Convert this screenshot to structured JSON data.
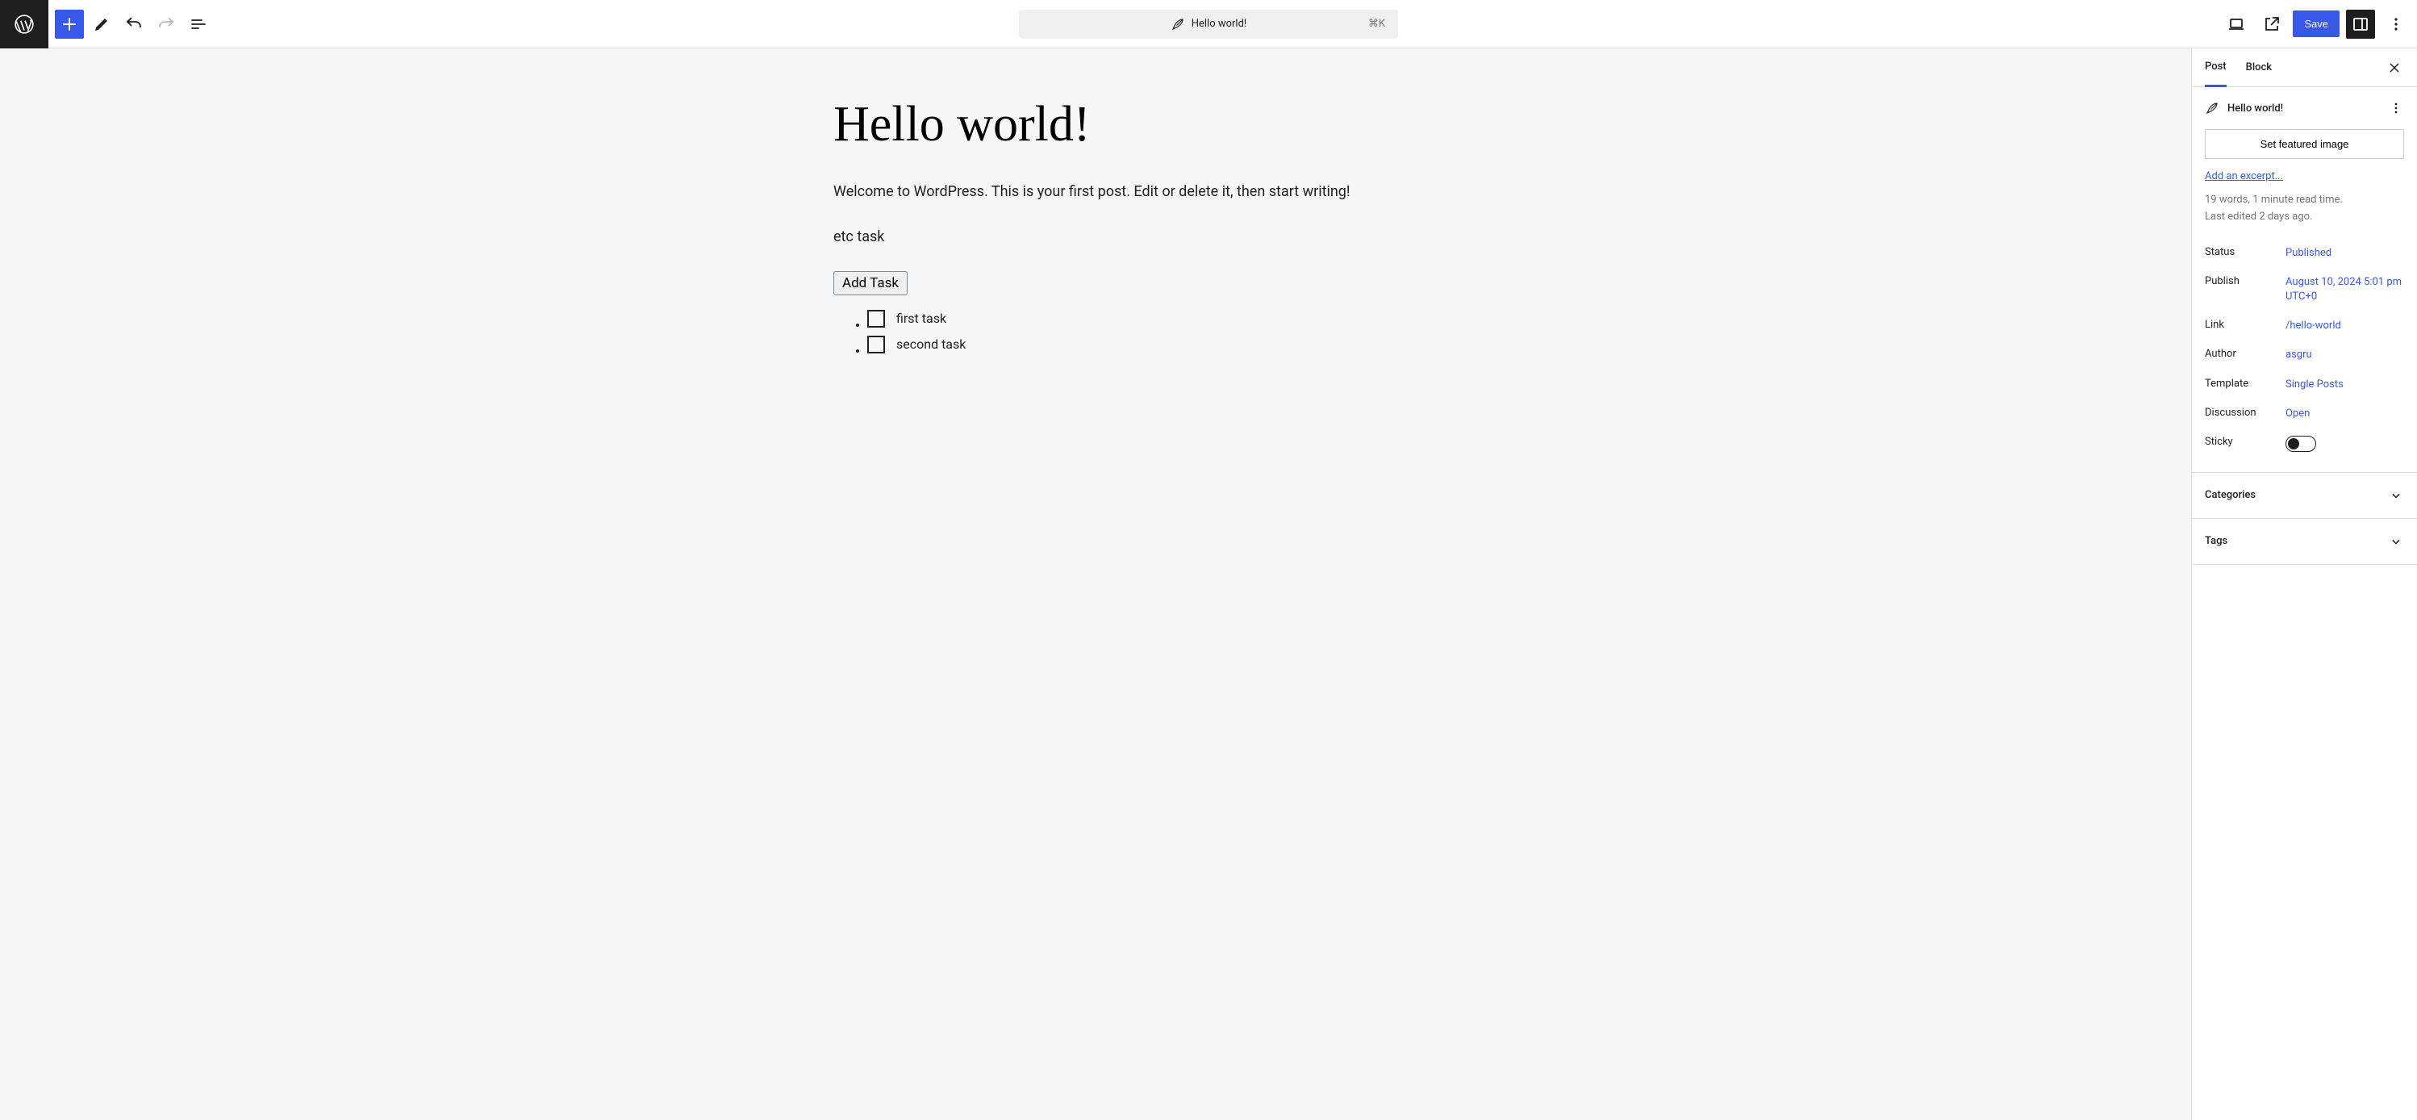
{
  "topbar": {
    "doc_title": "Hello world!",
    "kbd": "⌘K",
    "save_label": "Save"
  },
  "post": {
    "title": "Hello world!",
    "paragraph1": "Welcome to WordPress. This is your first post. Edit or delete it, then start writing!",
    "paragraph2": "etc task",
    "add_task_label": "Add Task",
    "tasks": [
      "first task",
      "second task"
    ]
  },
  "sidebar": {
    "tabs": {
      "post": "Post",
      "block": "Block"
    },
    "summary_title": "Hello world!",
    "featured_btn": "Set featured image",
    "excerpt_link": "Add an excerpt...",
    "word_count": "19 words, 1 minute read time.",
    "last_edit": "Last edited 2 days ago.",
    "meta": {
      "status_k": "Status",
      "status_v": "Published",
      "publish_k": "Publish",
      "publish_v": "August 10, 2024 5:01 pm UTC+0",
      "link_k": "Link",
      "link_v": "/hello-world",
      "author_k": "Author",
      "author_v": "asgru",
      "template_k": "Template",
      "template_v": "Single Posts",
      "discussion_k": "Discussion",
      "discussion_v": "Open",
      "sticky_k": "Sticky"
    },
    "panels": {
      "categories": "Categories",
      "tags": "Tags"
    }
  }
}
